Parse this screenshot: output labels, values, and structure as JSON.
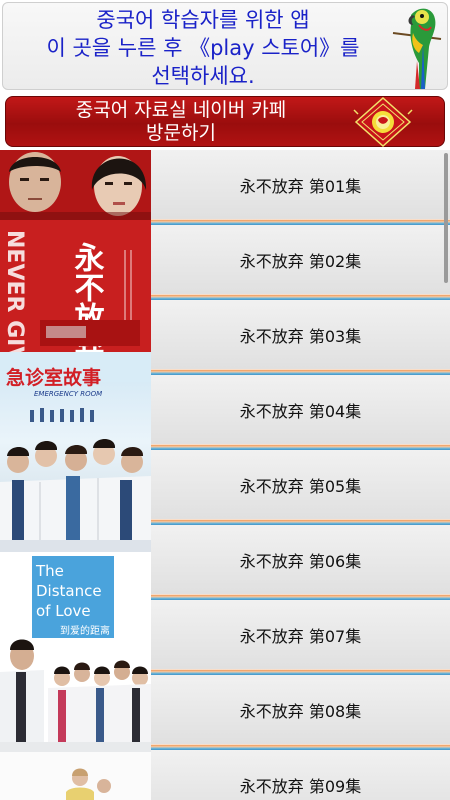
{
  "top_banner": {
    "line1": "중국어 학습자를 위한 앱",
    "line2": "이 곳을 누른 후 《play 스토어》를",
    "line3": "선택하세요."
  },
  "cafe_banner": {
    "line1": "중국어 자료실 네이버 카페",
    "line2": "방문하기"
  },
  "posters": [
    {
      "title_cn": "永不放弃",
      "title_en": "NEVER GIVE UP"
    },
    {
      "title_cn": "急诊室故事",
      "title_en": "EMERGENCY ROOM"
    },
    {
      "title_en": "The Distance of Love",
      "title_cn": "到爱的距离"
    }
  ],
  "episodes": [
    "永不放弃 第01集",
    "永不放弃 第02集",
    "永不放弃 第03集",
    "永不放弃 第04集",
    "永不放弃 第05集",
    "永不放弃 第06集",
    "永不放弃 第07集",
    "永不放弃 第08集",
    "永不放弃 第09集"
  ],
  "colors": {
    "banner_text": "#1a22c8",
    "cafe_red": "#b01212",
    "stripe_orange": "#ee9a5a",
    "stripe_blue": "#3f93c9"
  }
}
